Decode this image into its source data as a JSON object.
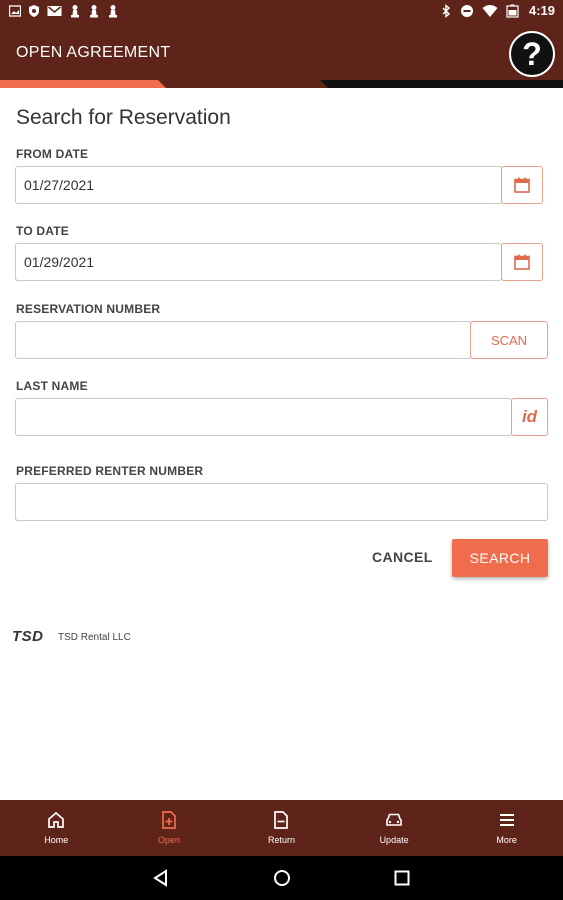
{
  "status_bar": {
    "time": "4:19",
    "left_icons": [
      "image-icon",
      "shield-icon",
      "gmail-icon",
      "chess-pawn-icon",
      "chess-pawn-icon",
      "chess-pawn-icon"
    ],
    "right_icons": [
      "bluetooth-icon",
      "do-not-disturb-icon",
      "wifi-icon",
      "battery-icon"
    ]
  },
  "header": {
    "title": "OPEN AGREEMENT",
    "help_label": "?"
  },
  "form": {
    "title": "Search for Reservation",
    "from_date": {
      "label": "FROM DATE",
      "value": "01/27/2021"
    },
    "to_date": {
      "label": "TO DATE",
      "value": "01/29/2021"
    },
    "reservation_number": {
      "label": "RESERVATION NUMBER",
      "value": "",
      "scan_label": "SCAN"
    },
    "last_name": {
      "label": "LAST NAME",
      "value": "",
      "id_label": "id"
    },
    "preferred_renter": {
      "label": "PREFERRED RENTER NUMBER",
      "value": ""
    },
    "cancel_label": "CANCEL",
    "search_label": "SEARCH"
  },
  "footer": {
    "logo_text": "TSD",
    "company": "TSD Rental LLC"
  },
  "bottom_nav": {
    "active": "Open",
    "items": [
      {
        "label": "Home",
        "icon": "home-icon"
      },
      {
        "label": "Open",
        "icon": "file-plus-icon"
      },
      {
        "label": "Return",
        "icon": "file-minus-icon"
      },
      {
        "label": "Update",
        "icon": "car-icon"
      },
      {
        "label": "More",
        "icon": "menu-icon"
      }
    ]
  },
  "colors": {
    "header": "#5e2319",
    "accent": "#ef6d4c",
    "android_bar": "#000000"
  }
}
